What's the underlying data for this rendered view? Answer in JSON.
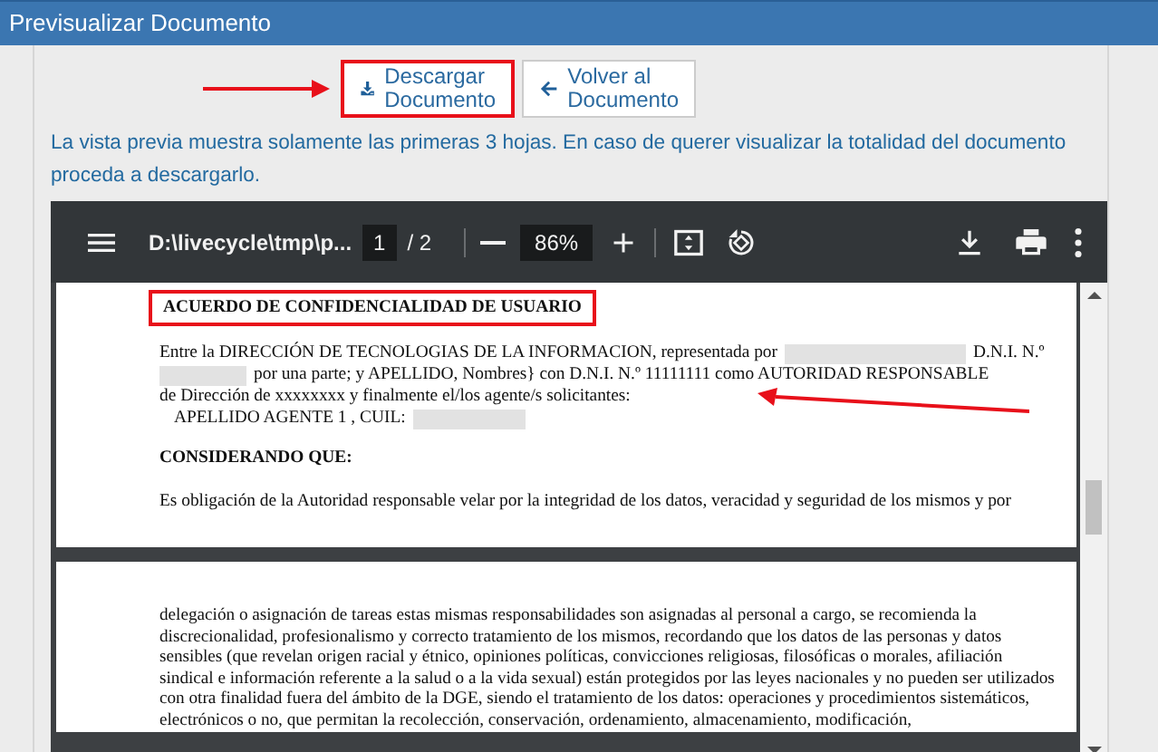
{
  "window": {
    "title": "Previsualizar Documento"
  },
  "buttons": [
    {
      "kind": "download",
      "label_lines": [
        "Descargar",
        "Documento"
      ],
      "highlighted": true,
      "pointer_arrow": true
    },
    {
      "kind": "back",
      "label_lines": [
        "Volver al",
        "Documento"
      ],
      "highlighted": false,
      "pointer_arrow": false
    }
  ],
  "notice": "La vista previa muestra solamente las primeras 3 hojas. En caso de querer visualizar la totalidad del documento proceda a descargarlo.",
  "viewer": {
    "file_name": "D:\\livecycle\\tmp\\p...",
    "page": "1",
    "page_total": "/ 2",
    "zoom": "86%",
    "pages": [
      {
        "title": "ACUERDO DE CONFIDENCIALIDAD DE USUARIO",
        "title_highlighted": true,
        "lines": [
          {
            "segments": [
              {
                "kind": "text",
                "text": "Entre la DIRECCIÓN DE TECNOLOGIAS DE LA INFORMACION, representada por"
              },
              {
                "kind": "redacted"
              },
              {
                "kind": "text",
                "text": "D.N.I. N.º"
              }
            ],
            "pointer_arrow": false
          },
          {
            "segments": [
              {
                "kind": "redacted"
              },
              {
                "kind": "text",
                "text": "por una parte; y APELLIDO, Nombres} con D.N.I. N.º 11111111 como AUTORIDAD RESPONSABLE"
              }
            ],
            "pointer_arrow": false
          },
          {
            "segments": [
              {
                "kind": "text",
                "text": "de Dirección de xxxxxxxx y finalmente el/los agente/s solicitantes:"
              }
            ],
            "pointer_arrow": true
          },
          {
            "segments": [
              {
                "kind": "text",
                "text": "APELLIDO AGENTE 1 , CUIL:"
              },
              {
                "kind": "redacted"
              }
            ],
            "pointer_arrow": false
          }
        ],
        "heading": "CONSIDERANDO QUE:",
        "paragraph": "Es obligación de la Autoridad responsable velar por la integridad de los datos, veracidad y seguridad de los mismos y por"
      },
      {
        "paragraph": "delegación o asignación de tareas estas mismas responsabilidades son asignadas al personal a cargo, se recomienda la discrecionalidad, profesionalismo y correcto tratamiento de los mismos, recordando que los datos de las personas y datos sensibles (que revelan origen racial y étnico, opiniones políticas, convicciones religiosas, filosóficas o morales, afiliación sindical e información referente a la salud o a la vida sexual) están protegidos por las leyes nacionales y no pueden ser utilizados con otra finalidad fuera del ámbito de la DGE, siendo el tratamiento de los datos: operaciones y procedimientos sistemáticos, electrónicos o no, que permitan la recolección, conservación, ordenamiento, almacenamiento, modificación,"
      }
    ]
  }
}
